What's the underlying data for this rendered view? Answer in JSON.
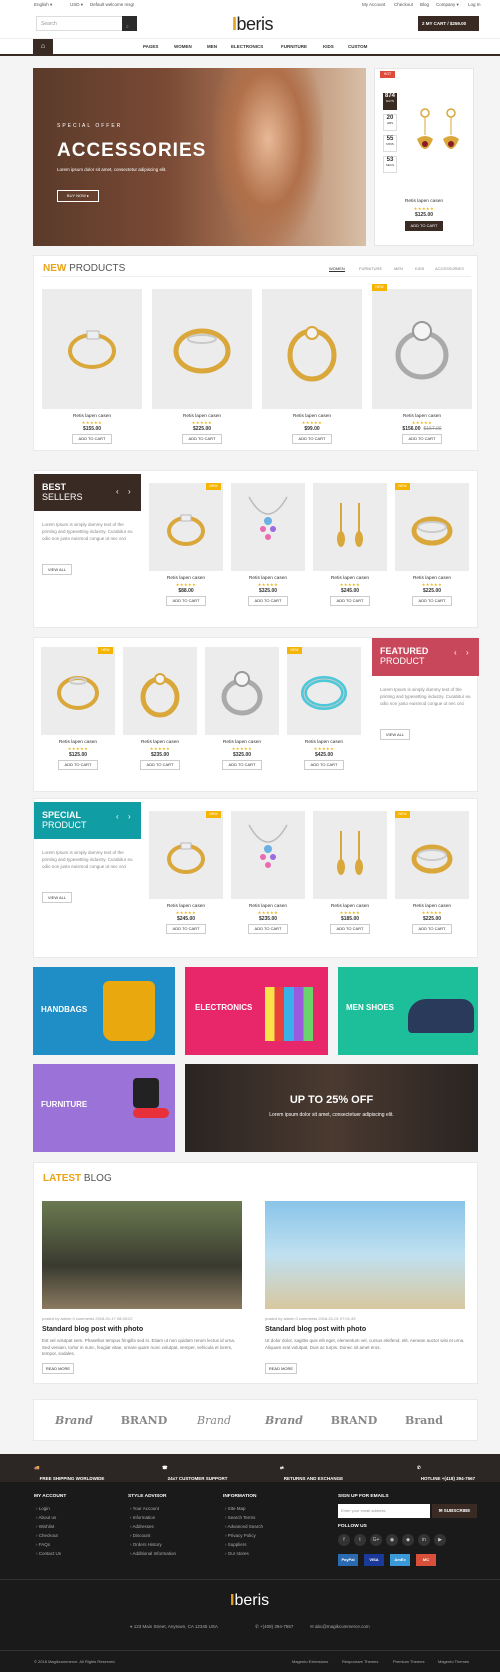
{
  "topbar": {
    "language": "English ▾",
    "currency": "USD ▾",
    "welcome": "Default welcome msg!",
    "links": [
      "My Account",
      "Checkout",
      "Blog",
      "Company ▾",
      "Log In"
    ]
  },
  "header": {
    "search_placeholder": "Search",
    "logo_mark": "I",
    "logo_text": "beris",
    "cart": "2  MY CART / $259.00"
  },
  "nav": {
    "items": [
      "PAGES",
      "WOMEN",
      "MEN",
      "ELECTRONICS",
      "FURNITURE",
      "KIDS",
      "CUSTOM"
    ]
  },
  "hero": {
    "eyebrow": "SPECIAL OFFER",
    "title": "ACCESSORIES",
    "subtitle": "Lorem ipsum dolor sit amet, consectetur adipiscing elit.",
    "button": "BUY NOW ▸"
  },
  "deal": {
    "badge": "HOT",
    "countdown": [
      {
        "value": "874",
        "unit": "DAYS"
      },
      {
        "value": "20",
        "unit": "HRS"
      },
      {
        "value": "55",
        "unit": "MINS"
      },
      {
        "value": "53",
        "unit": "SECS"
      }
    ],
    "name": "Retis lapen casen",
    "price": "$125.00",
    "button": "ADD TO CART"
  },
  "new_products": {
    "title_accent": "NEW",
    "title_rest": " PRODUCTS",
    "tabs": [
      "WOMEN",
      "FURNITURE",
      "MEN",
      "KIDS",
      "ACCESSORIES"
    ],
    "items": [
      {
        "name": "Retis lapen casen",
        "price": "$155.00",
        "old": ""
      },
      {
        "name": "Retis lapen casen",
        "price": "$225.00",
        "old": ""
      },
      {
        "name": "Retis lapen casen",
        "price": "$99.00",
        "old": ""
      },
      {
        "name": "Retis lapen casen",
        "price": "$156.00",
        "old": "$167.00",
        "badge": "NEW"
      }
    ]
  },
  "common": {
    "stars": "★★★★★",
    "add_to_cart": "ADD TO CART",
    "view_all": "VIEW ALL",
    "lorem": "Lorem Ipsum is simply dummy text of the printing and typesetting industry. Curabitur eu odio non justo euismod congue ut nec orci",
    "new": "NEW"
  },
  "best_sellers": {
    "t1": "BEST",
    "t2": "SELLERS",
    "items": [
      {
        "name": "Retis lapen casen",
        "price": "$88.00",
        "badge": "NEW"
      },
      {
        "name": "Retis lapen casen",
        "price": "$325.00"
      },
      {
        "name": "Retis lapen casen",
        "price": "$245.00"
      },
      {
        "name": "Retis lapen casen",
        "price": "$225.00",
        "badge": "NEW"
      }
    ]
  },
  "featured": {
    "t1": "FEATURED",
    "t2": "PRODUCT",
    "items": [
      {
        "name": "Retis lapen casen",
        "price": "$125.00",
        "badge": "NEW"
      },
      {
        "name": "Retis lapen casen",
        "price": "$235.00"
      },
      {
        "name": "Retis lapen casen",
        "price": "$325.00"
      },
      {
        "name": "Retis lapen casen",
        "price": "$425.00",
        "badge": "NEW"
      }
    ]
  },
  "special": {
    "t1": "SPECIAL",
    "t2": "PRODUCT",
    "items": [
      {
        "name": "Retis lapen casen",
        "price": "$245.00",
        "badge": "NEW"
      },
      {
        "name": "Retis lapen casen",
        "price": "$235.00"
      },
      {
        "name": "Retis lapen casen",
        "price": "$185.00"
      },
      {
        "name": "Retis lapen casen",
        "price": "$225.00",
        "badge": "NEW"
      }
    ]
  },
  "banners": {
    "handbags": "HANDBAGS",
    "electronics": "ELECTRONICS",
    "men_shoes": "MEN SHOES",
    "furniture": "FURNITURE",
    "sale_title": "UP TO 25% OFF",
    "sale_sub": "Lorem ipsum dolor sit amet, consectetuer adipiscing elit."
  },
  "blog": {
    "title_accent": "LATEST",
    "title_rest": " BLOG",
    "posts": [
      {
        "meta": "posted by admin    0 comments    2018-01-17 08:33:22",
        "title": "Standard blog post with photo",
        "text": "Est vel volutpat sem. Phasellus tempus fringilla sed in. Etiam ut non quidam rerum lectus id urna. Sed veniam, tortor in nunc, feugiat vitae, ornare quam nunc volutpat, semper, vehicula et lorem, tempor, sodales.",
        "button": "READ MORE"
      },
      {
        "meta": "posted by admin    0 comments    2018-01-01 07:01:49",
        "title": "Standard blog post with photo",
        "text": "Ut dolor dolor, sagittis quis elit eget, elementum vel, cursus eleifend, elit. Aenean auctor wisi et urna. Aliquam erat volutpat. Duis ac turpis. Donec sit amet eros.",
        "button": "READ MORE"
      }
    ]
  },
  "brands": [
    "Brand",
    "BRAND",
    "Brand",
    "Brand",
    "BRAND",
    "Brand"
  ],
  "services": [
    "FREE SHIPPING WORLDWIDE",
    "24x7 CUSTOMER SUPPORT",
    "RETURNS AND EXCHANGE",
    "HOTLINE +(418) 394-7567"
  ],
  "footer": {
    "col1": {
      "title": "MY ACCOUNT",
      "links": [
        "Login",
        "About us",
        "Wishlist",
        "Checkout",
        "FAQs",
        "Contact Us"
      ]
    },
    "col2": {
      "title": "STYLE ADVISOR",
      "links": [
        "Your Account",
        "Information",
        "Addresses",
        "Discount",
        "Orders History",
        "Additional Information"
      ]
    },
    "col3": {
      "title": "INFORMATION",
      "links": [
        "Site Map",
        "Search Terms",
        "Advanced Search",
        "Privacy Policy",
        "Suppliers",
        "Our stores"
      ]
    },
    "newsletter": {
      "title": "SIGN UP FOR EMAILS",
      "placeholder": "Enter your email address",
      "button": "SUBSCRIBE",
      "follow": "FOLLOW US"
    },
    "social": [
      "f",
      "t",
      "G+",
      "◉",
      "◆",
      "in",
      "▶"
    ],
    "payments": [
      "PayPal",
      "VISA",
      "AmEx",
      "MC"
    ],
    "logo_mark": "I",
    "logo_text": "beris",
    "address": "123 Main Street, Anytown, CA 12345 USA",
    "phone": "+(408) 394-7557",
    "email": "abc@magikcommerce.com",
    "copyright": "© 2018 Magikcommerce. All Rights Reserved.",
    "bottom_links": [
      "Magento Extensions",
      "Responsive Themes",
      "Premium Themes",
      "Magento Themes"
    ]
  },
  "colors": {
    "accent": "#e8a317",
    "dark": "#3a2a24",
    "featured": "#c8475a",
    "special": "#119da4"
  }
}
